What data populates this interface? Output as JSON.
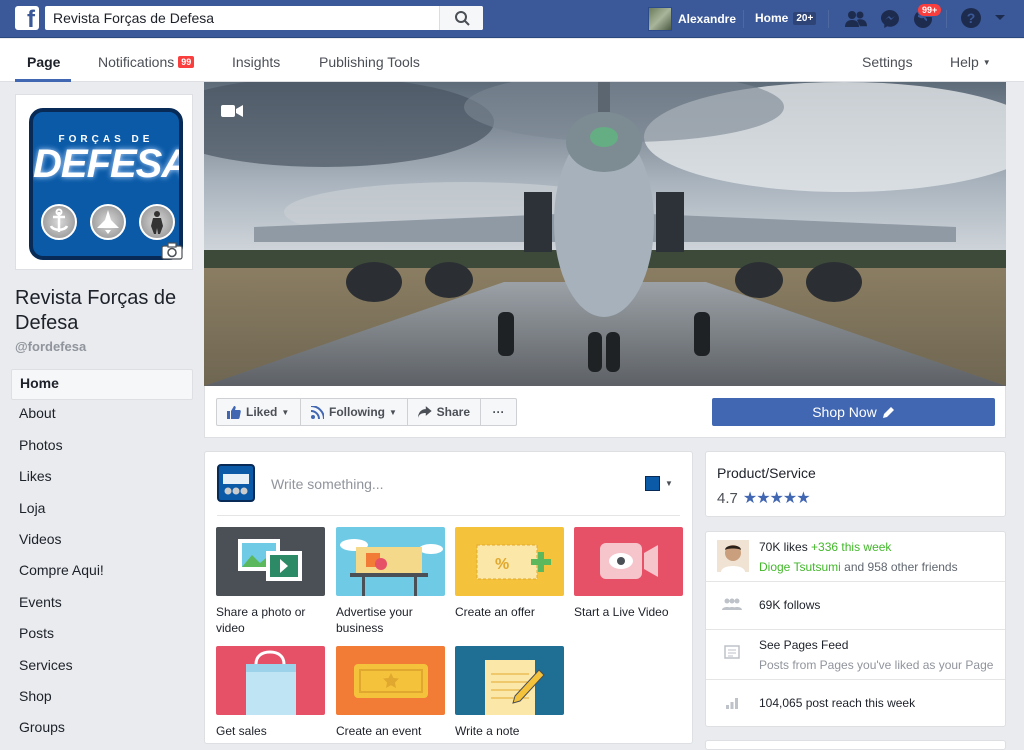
{
  "topbar": {
    "search_value": "Revista Forças de Defesa",
    "user_name": "Alexandre",
    "home_label": "Home",
    "home_badge": "20+",
    "notifications_badge": "99+"
  },
  "subnav": {
    "tabs": [
      {
        "label": "Page"
      },
      {
        "label": "Notifications",
        "badge": "99"
      },
      {
        "label": "Insights"
      },
      {
        "label": "Publishing Tools"
      }
    ],
    "settings_label": "Settings",
    "help_label": "Help"
  },
  "profile": {
    "logo_top_text": "FORÇAS DE",
    "logo_main_text": "DEFESA",
    "name": "Revista Forças de Defesa",
    "handle": "@fordefesa"
  },
  "leftnav": {
    "items": [
      "Home",
      "About",
      "Photos",
      "Likes",
      "Loja",
      "Videos",
      "Compre Aqui!",
      "Events",
      "Posts",
      "Services",
      "Shop",
      "Groups"
    ]
  },
  "actions": {
    "liked": "Liked",
    "following": "Following",
    "share": "Share",
    "more": "···",
    "shop_now": "Shop Now"
  },
  "composer": {
    "placeholder": "Write something...",
    "tiles": [
      {
        "label": "Share a photo or video",
        "color": "#4b4f56"
      },
      {
        "label": "Advertise your business",
        "color": "#6fcbe5"
      },
      {
        "label": "Create an offer",
        "color": "#f5c33b"
      },
      {
        "label": "Start a Live Video",
        "color": "#e65167"
      },
      {
        "label": "Get sales",
        "color": "#e65167"
      },
      {
        "label": "Create an event",
        "color": "#f27b35"
      },
      {
        "label": "Write a note",
        "color": "#1f6f95"
      }
    ]
  },
  "about": {
    "category": "Product/Service",
    "rating": "4.7",
    "stars": "★★★★★"
  },
  "stats": {
    "likes": "70K likes",
    "likes_delta": "+336 this week",
    "friend_name": "Dioge Tsutsumi",
    "friends_rest": "and 958 other friends",
    "follows": "69K follows",
    "pages_feed_title": "See Pages Feed",
    "pages_feed_sub": "Posts from Pages you've liked as your Page",
    "reach": "104,065 post reach this week"
  },
  "colors": {
    "brand": "#3b5998",
    "button_blue": "#4267b2",
    "badge_red": "#fa3e3e",
    "green": "#42b72a"
  }
}
